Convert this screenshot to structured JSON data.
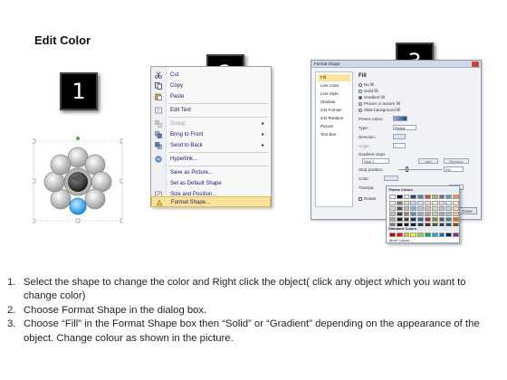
{
  "title": "Edit Color",
  "steps": [
    "1",
    "2",
    "3"
  ],
  "context_menu": {
    "items": [
      {
        "label": "Cut",
        "icon": "scissors-icon"
      },
      {
        "label": "Copy",
        "icon": "copy-icon"
      },
      {
        "label": "Paste",
        "icon": "paste-icon"
      },
      {
        "label": "Edit Text",
        "icon": "edit-text-icon"
      },
      {
        "label": "Group",
        "icon": "group-icon",
        "submenu": "▸",
        "disabled": true
      },
      {
        "label": "Bring to Front",
        "icon": "bring-front-icon",
        "submenu": "▸"
      },
      {
        "label": "Send to Back",
        "icon": "send-back-icon",
        "submenu": "▸"
      },
      {
        "label": "Hyperlink...",
        "icon": "hyperlink-icon"
      },
      {
        "label": "Save as Picture...",
        "icon": ""
      },
      {
        "label": "Set as Default Shape",
        "icon": ""
      },
      {
        "label": "Size and Position...",
        "icon": "size-icon"
      },
      {
        "label": "Format Shape...",
        "icon": "format-shape-icon",
        "highlighted": true
      }
    ]
  },
  "dialog": {
    "title": "Format Shape",
    "nav": [
      "Fill",
      "Line Color",
      "Line Style",
      "Shadow",
      "3-D Format",
      "3-D Rotation",
      "Picture",
      "Text Box"
    ],
    "fill_heading": "Fill",
    "fill_options": [
      {
        "label": "No fill",
        "selected": false
      },
      {
        "label": "Solid fill",
        "selected": false
      },
      {
        "label": "Gradient fill",
        "selected": true
      },
      {
        "label": "Picture or texture fill",
        "selected": false
      },
      {
        "label": "Slide background fill",
        "selected": false
      }
    ],
    "preset_colors": "Preset colors:",
    "type_label": "Type:",
    "type_value": "Radial",
    "direction_label": "Direction:",
    "angle_label": "Angle:",
    "angle_value": "0°",
    "gradient_stops": "Gradient stops",
    "stop_value": "Stop 1",
    "add_button": "Add",
    "remove_button": "Remove",
    "stop_position_label": "Stop position:",
    "stop_position_value": "0%",
    "color_label": "Color:",
    "transparency_label": "Transpa",
    "rotate_label": "Rotate",
    "close_button": "Close"
  },
  "picker": {
    "theme_heading": "Theme Colors",
    "standard_heading": "Standard Colors",
    "more": "More Colors...",
    "theme_top": [
      "#ffffff",
      "#000000",
      "#eeece1",
      "#1f497d",
      "#4f81bd",
      "#c0504d",
      "#9bbb59",
      "#8064a2",
      "#4bacc6",
      "#f79646"
    ],
    "theme_shades": [
      [
        "#f2f2f2",
        "#7f7f7f",
        "#ddd9c3",
        "#c6d9f0",
        "#dbe5f1",
        "#f2dcdb",
        "#ebf1dd",
        "#e5e0ec",
        "#dbeef3",
        "#fdeada"
      ],
      [
        "#d8d8d8",
        "#595959",
        "#c4bd97",
        "#8db3e2",
        "#b8cce4",
        "#e5b9b7",
        "#d7e3bc",
        "#ccc1d9",
        "#b7dde8",
        "#fbd5b5"
      ],
      [
        "#bfbfbf",
        "#3f3f3f",
        "#938953",
        "#548dd4",
        "#95b3d7",
        "#d99694",
        "#c3d69b",
        "#b2a2c7",
        "#92cddc",
        "#fac08f"
      ],
      [
        "#a5a5a5",
        "#262626",
        "#494429",
        "#17365d",
        "#366092",
        "#953734",
        "#76923c",
        "#5f497a",
        "#31859b",
        "#e36c09"
      ],
      [
        "#7f7f7f",
        "#0c0c0c",
        "#1d1b10",
        "#0f243e",
        "#244061",
        "#632423",
        "#4f6128",
        "#3f3151",
        "#205867",
        "#974806"
      ]
    ],
    "standard": [
      "#c00000",
      "#ff0000",
      "#ffc000",
      "#ffff00",
      "#92d050",
      "#00b050",
      "#00b0f0",
      "#0070c0",
      "#002060",
      "#7030a0"
    ]
  },
  "instructions": [
    {
      "num": "1.",
      "text": "Select the shape to change the color and Right click the object( click any object which you want to change color)"
    },
    {
      "num": "2.",
      "text": "Choose Format Shape in the dialog box."
    },
    {
      "num": "3.",
      "text": "Choose “Fill” in the Format Shape box then “Solid” or “Gradient” depending on the appearance of the object. Change colour as shown in the picture."
    }
  ]
}
